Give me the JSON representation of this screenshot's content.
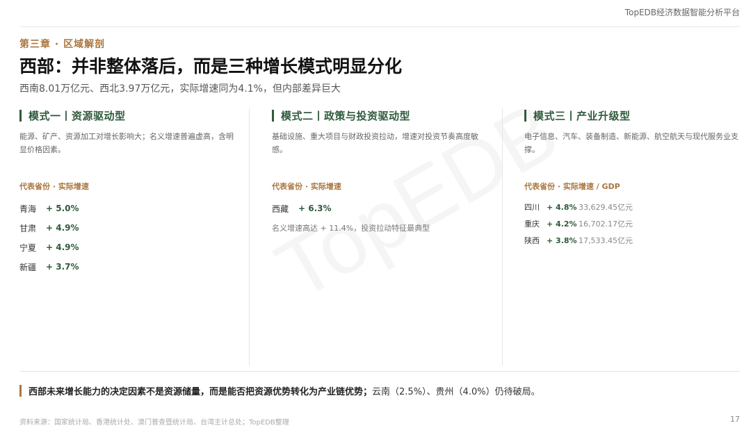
{
  "header": {
    "brand": "TopEDB经济数据智能分析平台"
  },
  "chapter": "第三章 · 区域解剖",
  "title": "西部：并非整体落后，而是三种增长模式明显分化",
  "subtitle": "西南8.01万亿元、西北3.97万亿元，实际增速同为4.1%，但内部差异巨大",
  "watermark": "TopEDB",
  "columns": [
    {
      "title": "模式一丨资源驱动型",
      "desc": "能源、矿产、资源加工对增长影响大；名义增速普遍虚高，含明显价格因素。",
      "label": "代表省份 · 实际增速",
      "rows": [
        {
          "province": "青海",
          "growth": "+ 5.0%"
        },
        {
          "province": "甘肃",
          "growth": "+ 4.9%"
        },
        {
          "province": "宁夏",
          "growth": "+ 4.9%"
        },
        {
          "province": "新疆",
          "growth": "+ 3.7%"
        }
      ]
    },
    {
      "title": "模式二丨政策与投资驱动型",
      "desc": "基础设施、重大项目与财政投资拉动，增速对投资节奏高度敏感。",
      "label": "代表省份 · 实际增速",
      "rows": [
        {
          "province": "西藏",
          "growth": "+ 6.3%"
        }
      ],
      "note": "名义增速高达 + 11.4%，投资拉动特征最典型"
    },
    {
      "title": "模式三丨产业升级型",
      "desc": "电子信息、汽车、装备制造、新能源、航空航天与现代服务业支撑。",
      "label": "代表省份 · 实际增速 / GDP",
      "rows": [
        {
          "province": "四川",
          "growth": "+ 4.8%",
          "gdp": "33,629.45亿元"
        },
        {
          "province": "重庆",
          "growth": "+ 4.2%",
          "gdp": "16,702.17亿元"
        },
        {
          "province": "陕西",
          "growth": "+ 3.8%",
          "gdp": "17,533.45亿元"
        }
      ]
    }
  ],
  "conclusion": {
    "bold": "西部未来增长能力的决定因素不是资源储量，而是能否把资源优势转化为产业链优势；",
    "rest": "云南（2.5%）、贵州（4.0%）仍待破局。"
  },
  "footer": {
    "source": "资料来源：国家统计局、香港统计处、澳门普查暨统计局、台湾主计总处；TopEDB整理",
    "page": "17"
  },
  "colors": {
    "green": "#2f5a3c",
    "gold": "#a9763f"
  }
}
